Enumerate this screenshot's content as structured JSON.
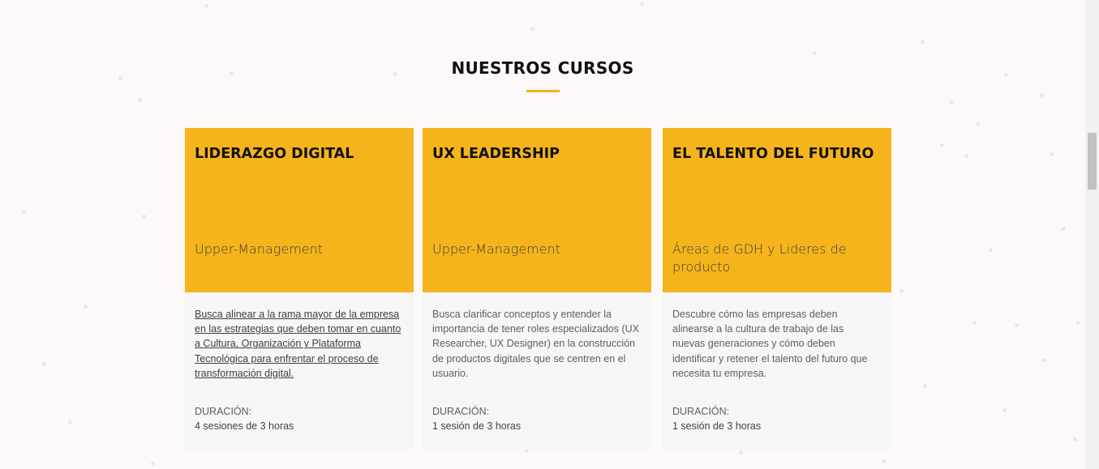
{
  "section": {
    "title": "NUESTROS CURSOS"
  },
  "courses": [
    {
      "title": "LIDERAZGO DIGITAL",
      "audience": "Upper-Management",
      "description": "Busca alinear a la rama mayor de la empresa en las estrategias que deben tomar en cuanto a Cultura, Organización y Plataforma Tecnológica para enfrentar el proceso de transformación digital.",
      "duration_label": "DURACIÓN:",
      "duration_value": "4 sesiones de 3 horas"
    },
    {
      "title": "UX LEADERSHIP",
      "audience": "Upper-Management",
      "description": "Busca clarificar conceptos y entender la importancia de tener roles especializados (UX Researcher, UX Designer) en la construcción de productos digitales que se centren en el usuario.",
      "duration_label": "DURACIÓN:",
      "duration_value": "1 sesión de 3 horas"
    },
    {
      "title": "EL TALENTO DEL FUTURO",
      "audience": "Áreas de GDH y Lideres de producto",
      "description": "Descubre cómo las empresas deben alinearse a la cultura de trabajo de las nuevas generaciones y cómo deben identificar y retener el talento del futuro que necesita tu empresa.",
      "duration_label": "DURACIÓN:",
      "duration_value": "1 sesión de 3 horas"
    }
  ],
  "colors": {
    "accent": "#f5b41b",
    "page_background": "#fdf9f8",
    "card_body_background": "#f6f6f6",
    "title_text": "#111111"
  }
}
